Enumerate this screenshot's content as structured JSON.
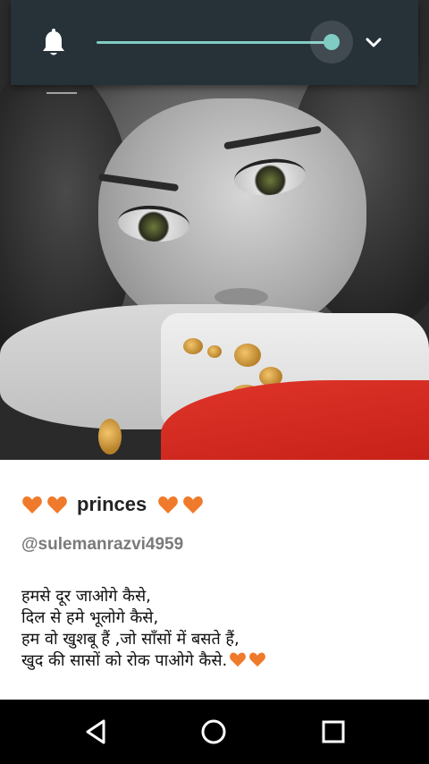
{
  "volume_panel": {
    "icon": "bell-icon",
    "level": 0.95,
    "accent_color": "#80cbc4",
    "background_color": "#263238",
    "expand_icon": "chevron-down-icon"
  },
  "post": {
    "name": "princes",
    "name_decoration_icon": "heart-icon",
    "heart_color": "#ef7a2b",
    "username": "@sulemanrazvi4959",
    "poem": {
      "line1": "हमसे दूर  जाओगे  कैसे,",
      "line2": "दिल से हमे भूलोगे कैसे,",
      "line3": "हम वो खुशबू हैं ,जो साँसों में बसते हैं,",
      "line4": "खुद की सासों को रोक पाओगे कैसे."
    }
  },
  "navbar": {
    "back_icon": "back-triangle-icon",
    "home_icon": "home-circle-icon",
    "recents_icon": "recents-square-icon"
  }
}
